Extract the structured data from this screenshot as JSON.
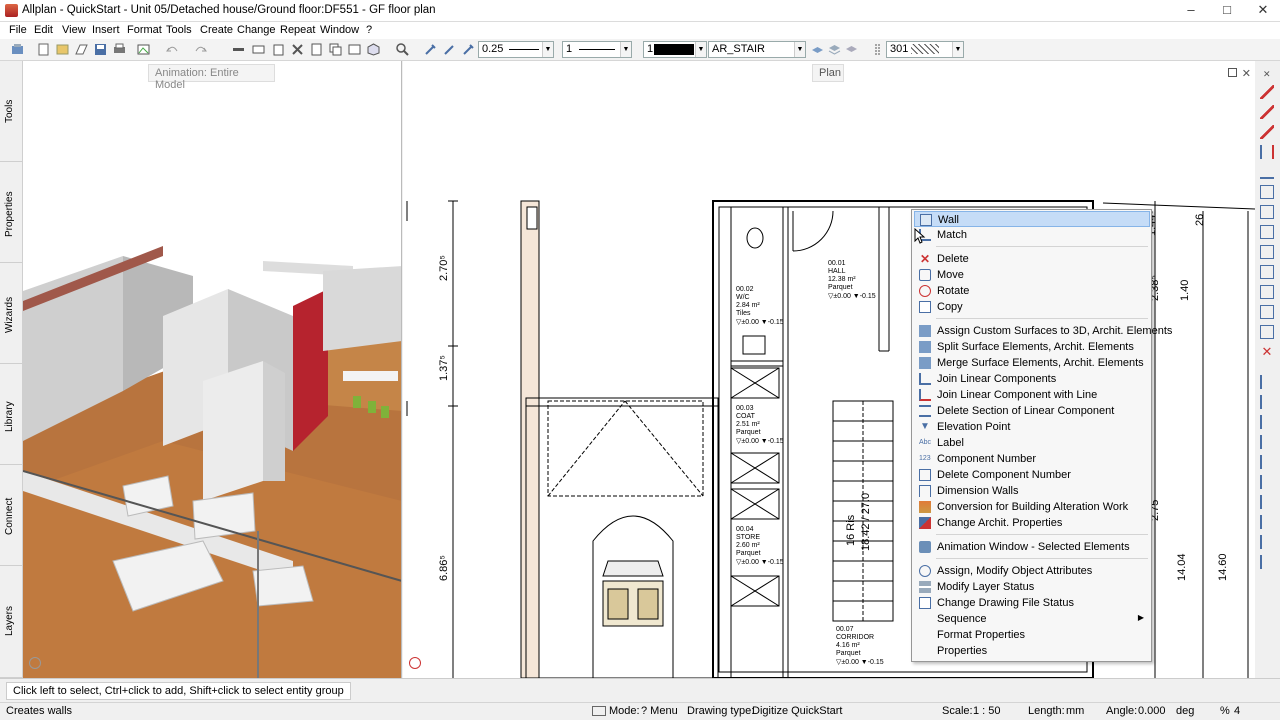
{
  "window": {
    "title": "Allplan - QuickStart - Unit 05/Detached house/Ground floor:DF551 - GF floor plan",
    "min": "–",
    "max": "□",
    "close": "✕"
  },
  "menu": [
    "File",
    "Edit",
    "View",
    "Insert",
    "Format",
    "Tools",
    "Create",
    "Change",
    "Repeat",
    "Window",
    "?"
  ],
  "toolbar": {
    "pen": "0.25",
    "line": "1",
    "color": "1",
    "layer": "AR_STAIR",
    "hatch": "301"
  },
  "left_tabs": [
    "Tools",
    "Properties",
    "Wizards",
    "Library",
    "Connect",
    "Layers"
  ],
  "views": {
    "left_label": "Animation: Entire Model",
    "right_label": "Plan"
  },
  "plan": {
    "dims": [
      "2.70⁵",
      "1.37⁵",
      "6.86⁵",
      "1.44⁸",
      "26",
      "2.38⁵",
      "1.40",
      "2.75",
      "14.04",
      "14.60",
      "16 Ris",
      "18.42 / 27.0"
    ],
    "rooms": [
      {
        "id": "00.01",
        "name": "HALL",
        "area": "12.38 m²",
        "floor": "Parquet",
        "lvl": "▽±0.00  ▼-0.15"
      },
      {
        "id": "00.02",
        "name": "W/C",
        "area": "2.84 m²",
        "floor": "Tiles",
        "lvl": "▽±0.00  ▼-0.15"
      },
      {
        "id": "00.03",
        "name": "COAT",
        "area": "2.51 m²",
        "floor": "Parquet",
        "lvl": "▽±0.00  ▼-0.15"
      },
      {
        "id": "00.04",
        "name": "STORE",
        "area": "2.60 m²",
        "floor": "Parquet",
        "lvl": "▽±0.00  ▼-0.15"
      },
      {
        "id": "00.07",
        "name": "CORRIDOR",
        "area": "4.16 m²",
        "floor": "Parquet",
        "lvl": "▽±0.00  ▼-0.15"
      }
    ]
  },
  "context_menu": {
    "items": [
      {
        "label": "Wall",
        "icon": "wall-icon",
        "highlight": true
      },
      {
        "label": "Match",
        "icon": "match-icon"
      },
      {
        "label": "Delete",
        "icon": "delete-icon"
      },
      {
        "label": "Move",
        "icon": "move-icon"
      },
      {
        "label": "Rotate",
        "icon": "rotate-icon"
      },
      {
        "label": "Copy",
        "icon": "copy-icon"
      },
      {
        "label": "Assign Custom Surfaces to 3D, Archit. Elements",
        "icon": "surface-icon"
      },
      {
        "label": "Split Surface Elements, Archit. Elements",
        "icon": "split-icon"
      },
      {
        "label": "Merge Surface Elements, Archit. Elements",
        "icon": "merge-icon"
      },
      {
        "label": "Join Linear Components",
        "icon": "join-icon"
      },
      {
        "label": "Join Linear Component with Line",
        "icon": "join-line-icon"
      },
      {
        "label": "Delete Section of Linear Component",
        "icon": "delete-section-icon"
      },
      {
        "label": "Elevation Point",
        "icon": "elevation-icon"
      },
      {
        "label": "Label",
        "icon": "label-icon"
      },
      {
        "label": "Component Number",
        "icon": "number-icon"
      },
      {
        "label": "Delete Component Number",
        "icon": "delete-number-icon"
      },
      {
        "label": "Dimension Walls",
        "icon": "dimension-icon"
      },
      {
        "label": "Conversion for Building Alteration Work",
        "icon": "conversion-icon"
      },
      {
        "label": "Change Archit. Properties",
        "icon": "properties-icon"
      },
      {
        "label": "Animation Window - Selected Elements",
        "icon": "animation-icon"
      },
      {
        "label": "Assign, Modify Object Attributes",
        "icon": "attributes-icon"
      },
      {
        "label": "Modify Layer Status",
        "icon": "layer-icon"
      },
      {
        "label": "Change Drawing File Status",
        "icon": "drawing-file-icon"
      },
      {
        "label": "Sequence",
        "icon": "",
        "submenu": true
      },
      {
        "label": "Format Properties",
        "icon": ""
      },
      {
        "label": "Properties",
        "icon": ""
      }
    ]
  },
  "hint": "Click left to select, Ctrl+click to add, Shift+click to select entity group",
  "status": {
    "left": "Creates walls",
    "mode_label": "Mode:",
    "mode": "? Menu",
    "drawing_type_label": "Drawing type:",
    "drawing_type": "Digitize QuickStart",
    "scale_label": "Scale:",
    "scale": "1 : 50",
    "length_label": "Length:",
    "length": "mm",
    "angle_label": "Angle:",
    "angle": "0.000",
    "angle_unit": "deg",
    "pct": "%",
    "pct_val": "4"
  }
}
